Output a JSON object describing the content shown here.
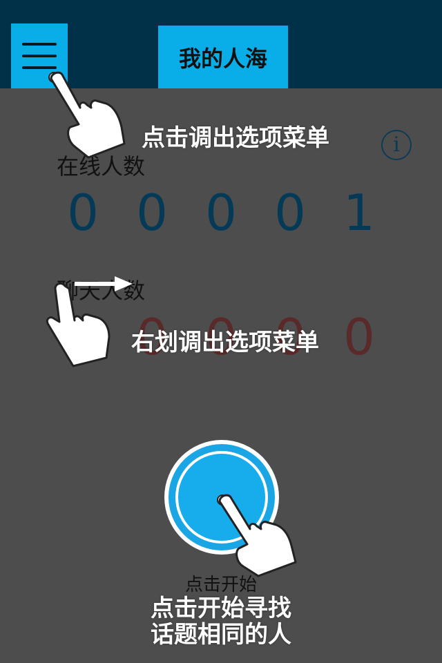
{
  "header": {
    "title": "我的人海"
  },
  "stats": {
    "online_label": "在线人数",
    "online_digits": [
      "0",
      "0",
      "0",
      "0",
      "1"
    ],
    "chat_label": "聊天人数",
    "chat_digits": [
      "0",
      "0",
      "0",
      "0",
      "0"
    ]
  },
  "start": {
    "label": "点击开始"
  },
  "hints": {
    "tap_menu": "点击调出选项菜单",
    "swipe_menu": "右划调出选项菜单",
    "start_line1": "点击开始寻找",
    "start_line2": "话题相同的人"
  },
  "colors": {
    "topbar": "#003148",
    "accent": "#09aee8",
    "background": "#4d4d4d",
    "online_digits": "#053a57",
    "chat_digits": "#5a2a2a"
  },
  "icons": [
    "hamburger-menu-icon",
    "info-icon",
    "tap-hand-icon",
    "swipe-hand-icon",
    "arrow-right-icon"
  ]
}
